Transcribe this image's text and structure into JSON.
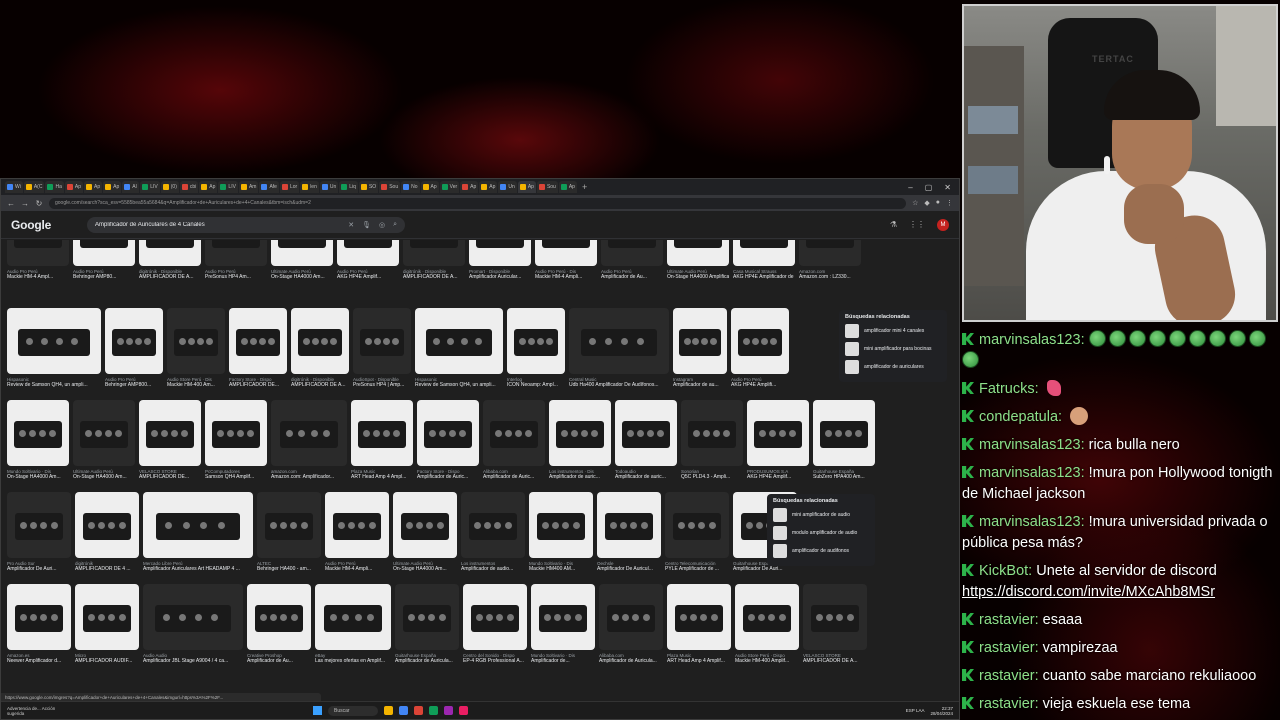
{
  "browser": {
    "tabs": [
      {
        "label": "Wi",
        "color": "#4285f4"
      },
      {
        "label": "A(C",
        "color": "#f4b400"
      },
      {
        "label": "Ha",
        "color": "#0f9d58"
      },
      {
        "label": "Ap",
        "color": "#db4437"
      },
      {
        "label": "Ap",
        "color": "#f4b400"
      },
      {
        "label": "Ap",
        "color": "#f4b400"
      },
      {
        "label": "Al",
        "color": "#4285f4"
      },
      {
        "label": "LIV",
        "color": "#0f9d58"
      },
      {
        "label": "(0)",
        "color": "#f4b400"
      },
      {
        "label": "cbi",
        "color": "#db4437"
      },
      {
        "label": "Ap",
        "color": "#f4b400"
      },
      {
        "label": "LIV",
        "color": "#0f9d58"
      },
      {
        "label": "Am",
        "color": "#f4b400"
      },
      {
        "label": "Afe",
        "color": "#4285f4"
      },
      {
        "label": "Lor",
        "color": "#db4437"
      },
      {
        "label": "len",
        "color": "#f4b400"
      },
      {
        "label": "Un",
        "color": "#4285f4"
      },
      {
        "label": "Liq",
        "color": "#0f9d58"
      },
      {
        "label": "SO",
        "color": "#f4b400"
      },
      {
        "label": "Sou",
        "color": "#db4437"
      },
      {
        "label": "No",
        "color": "#4285f4"
      },
      {
        "label": "Ap",
        "color": "#f4b400"
      },
      {
        "label": "Ver",
        "color": "#0f9d58"
      },
      {
        "label": "Ap",
        "color": "#db4437"
      },
      {
        "label": "Ap",
        "color": "#f4b400"
      },
      {
        "label": "Un",
        "color": "#4285f4"
      },
      {
        "label": "Ap",
        "color": "#f4b400"
      },
      {
        "label": "Sou",
        "color": "#db4437"
      },
      {
        "label": "Ap",
        "color": "#0f9d58"
      }
    ],
    "url": "google.com/search?sca_esv=5585bea55a5684&q=Amplificador+de+Auriculares+de+4+Canales&tbm=isch&udm=2",
    "window_controls": {
      "minimize": "–",
      "maximize": "▢",
      "close": "✕"
    },
    "new_tab": "+"
  },
  "google": {
    "logo": "Google",
    "query": "Amplificador de Auriculares de 4 Canales",
    "clear": "✕",
    "avatar": "M"
  },
  "rows": [
    {
      "cards": [
        {
          "src": "Audio Pro Perú",
          "title": "Mackie HM-4 Ampl..."
        },
        {
          "src": "Audio Pro Perú",
          "title": "Behringer AMP80..."
        },
        {
          "src": "digitrónik · Disponible",
          "title": "AMPLIFICADOR DE A..."
        },
        {
          "src": "Audio Pro Perú",
          "title": "PreSonus HP4 Am..."
        },
        {
          "src": "Ultimate Audio Perú",
          "title": "On-Stage HA4000 Am..."
        },
        {
          "src": "Audio Pro Perú",
          "title": "AKG HP4E Amplif..."
        },
        {
          "src": "digitrónik · Disponible",
          "title": "AMPLIFICADOR DE A..."
        },
        {
          "src": "Promart · Disponible",
          "title": "Amplificador Auricular..."
        },
        {
          "src": "Audio Pro Perú · Dis",
          "title": "Mackie HM-4 Ampli..."
        },
        {
          "src": "Audio Pro Perú",
          "title": "Amplificador de Au..."
        },
        {
          "src": "Ultimate Audio Perú",
          "title": "On-Stage HA4000 Amplificador de Au..."
        },
        {
          "src": "Casa Musical Strauss",
          "title": "AKG HP4E Amplificador de audifon..."
        },
        {
          "src": "Amazon.com",
          "title": "Amazon.com : LZ330..."
        }
      ]
    },
    {
      "cards": [
        {
          "src": "Hispasonic",
          "title": "Review de Samson QH4, un ampli..."
        },
        {
          "src": "Audio Pro Perú",
          "title": "Behringer AMP800..."
        },
        {
          "src": "Audio Store Perú · Dis",
          "title": "Mackie HM-400 Am..."
        },
        {
          "src": "Factory Store · Dispo",
          "title": "AMPLIFICADOR DE..."
        },
        {
          "src": "digitrónik · Disponible",
          "title": "AMPLIFICADOR DE A..."
        },
        {
          "src": "AudioSpot · Disponible",
          "title": "PreSonus HP4 | Amp..."
        },
        {
          "src": "Hispasonic",
          "title": "Review de Samson QH4, un ampli..."
        },
        {
          "src": "Interlog",
          "title": "ICON Neoamp: Ampl..."
        },
        {
          "src": "Central Music",
          "title": "Udb Ha400 Amplificador De Audífonos..."
        },
        {
          "src": "Instagram",
          "title": "Amplificador de au..."
        },
        {
          "src": "Audio Pro Perú",
          "title": "AKG HP4E Amplifi..."
        }
      ],
      "related": {
        "title": "Búsquedas relacionadas",
        "items": [
          "amplificador mini 4 canales",
          "mini amplificador para bocinas",
          "amplificador de auriculares"
        ]
      }
    },
    {
      "cards": [
        {
          "src": "Mundo Soltivario · Dis",
          "title": "On-Stage HA4000 Am..."
        },
        {
          "src": "Ultimate Audio Perú",
          "title": "On-Stage HA4000 Am..."
        },
        {
          "src": "VELASCO STORE",
          "title": "AMPLIFICADOR DE..."
        },
        {
          "src": "PcComputadores",
          "title": "Samson QH4 Amplif..."
        },
        {
          "src": "amazon.com",
          "title": "Amazon.com: Amplificador..."
        },
        {
          "src": "Plaza Music",
          "title": "ART Head Amp 4 Ampl..."
        },
        {
          "src": "Factory Store · Dispo",
          "title": "Amplificador de Auric..."
        },
        {
          "src": "Alibaba.com",
          "title": "Amplificador de Auric..."
        },
        {
          "src": "Los instrumentos · Dis",
          "title": "Amplificador de auric..."
        },
        {
          "src": "Todoaudio",
          "title": "Amplificador de auric..."
        },
        {
          "src": "Sonorian",
          "title": "Q5C PLD4.3 - Ampli..."
        },
        {
          "src": "PRODUSUMOS S.A",
          "title": "AKG HP4E Amplif..."
        },
        {
          "src": "Guitarhouse España",
          "title": "SubZero HPA400 Am..."
        }
      ]
    },
    {
      "cards": [
        {
          "src": "Pro Audio Sur",
          "title": "Amplificador De Auri..."
        },
        {
          "src": "digitrónik",
          "title": "AMPLIFICADOR DE 4 ..."
        },
        {
          "src": "Mercado Libre Perú",
          "title": "Amplificador Auriculares Art HEADAMP 4 ..."
        },
        {
          "src": "ALTEC",
          "title": "Behringer HA400 - am..."
        },
        {
          "src": "Audio Pro Perú",
          "title": "Mackie HM-4 Ampli..."
        },
        {
          "src": "Ultimate Audio Perú",
          "title": "On-Stage HA4000 Am..."
        },
        {
          "src": "Los instrumentos",
          "title": "Amplificador de audio..."
        },
        {
          "src": "Mundo Soltivario · Dis",
          "title": "Mackie HM400 AM..."
        },
        {
          "src": "Oechsle",
          "title": "Amplificador De Auricul..."
        },
        {
          "src": "Centro Telecomunicación",
          "title": "PYLE Amplificador de ..."
        },
        {
          "src": "Guitarhouse España",
          "title": "Amplificador De Auri..."
        }
      ],
      "related": {
        "title": "Búsquedas relacionadas",
        "items": [
          "mini amplificador de audio",
          "modulo amplificador de audio",
          "amplificador de audifonos"
        ]
      }
    },
    {
      "cards": [
        {
          "src": "Amazon.es",
          "title": "Neewer Amplificador d..."
        },
        {
          "src": "Micro",
          "title": "AMPLIFICADOR AUDIF..."
        },
        {
          "src": "Audio Audio",
          "title": "Amplificador JBL Stage A9004 / 4 ca..."
        },
        {
          "src": "Creative Proshop",
          "title": "Amplificador de Au..."
        },
        {
          "src": "eBay",
          "title": "Las mejores ofertas en Amplif..."
        },
        {
          "src": "Guitarhouse España",
          "title": "Amplificador de Auricula..."
        },
        {
          "src": "Centro del Sonido · Dispo",
          "title": "EP-4 RGB Professional A..."
        },
        {
          "src": "Mundo Soltivario · Dis",
          "title": "Amplificador de..."
        },
        {
          "src": "Alibaba.com",
          "title": "Amplificador de Auricula..."
        },
        {
          "src": "Plaza Music",
          "title": "ART Head Amp 4 Amplif..."
        },
        {
          "src": "Audio Store Perú · Dispo",
          "title": "Mackie HM-400 Amplif..."
        },
        {
          "src": "VELASCO STORE",
          "title": "AMPLIFICADOR DE A..."
        }
      ]
    }
  ],
  "status_url": "https://www.google.com/imgres?q=Amplificador+de+Auriculares+de+4+Canales&imgurl=https%3A%2F%2F...",
  "taskbar": {
    "notice": "Advertencia de... Acción sugerida",
    "search": "Buscar",
    "lang": "ESP LAA",
    "time": "22:37",
    "date": "28/04/2024"
  },
  "webcam": {
    "chair_brand": "TERTAC"
  },
  "chat": {
    "messages": [
      {
        "user": "marvinsalas123",
        "text": "",
        "emotes": 10
      },
      {
        "user": "Fatrucks",
        "text": "",
        "emote": "pink"
      },
      {
        "user": "condepatula",
        "text": "",
        "emote": "fist"
      },
      {
        "user": "marvinsalas123",
        "text": "rica bulla nero"
      },
      {
        "user": "marvinsalas123",
        "text": "!mura pon Hollywood tonigth de Michael jackson"
      },
      {
        "user": "marvinsalas123",
        "text": "!mura universidad privada o pública pesa más?"
      },
      {
        "user": "KickBot",
        "text": "Unete al servidor de discord ",
        "link": "https://discord.com/invite/MXcAhb8MSr"
      },
      {
        "user": "rastavier",
        "text": "esaaa"
      },
      {
        "user": "rastavier",
        "text": "vampirezaa"
      },
      {
        "user": "rastavier",
        "text": "cuanto sabe marciano rekuliaooo"
      },
      {
        "user": "rastavier",
        "text": "vieja eskuela ese tema"
      }
    ],
    "colors": {
      "user": "#8ee08a",
      "badge": "#2db34a"
    }
  }
}
